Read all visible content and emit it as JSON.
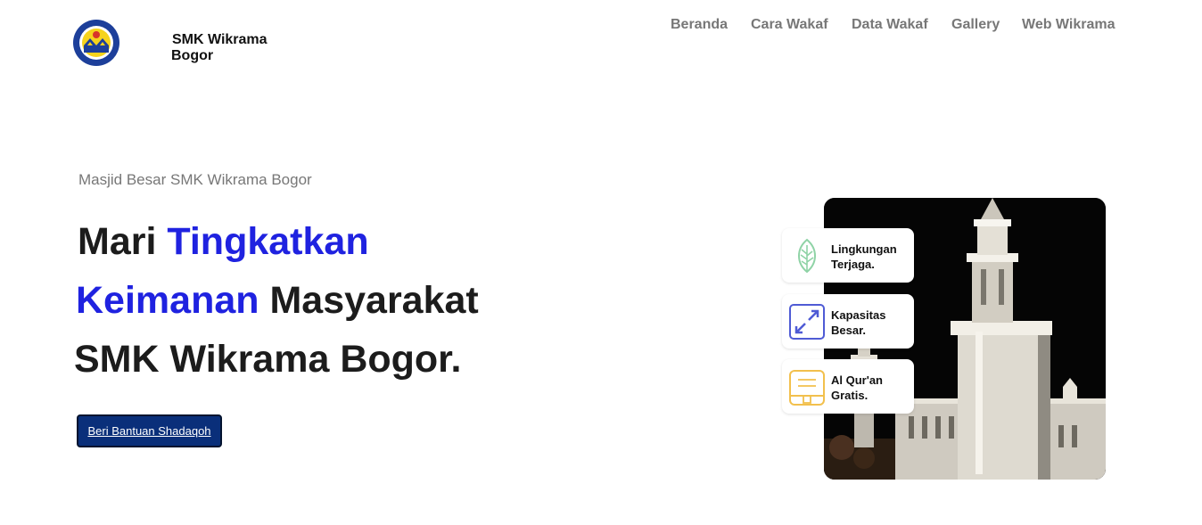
{
  "header": {
    "brand_line1": "SMK Wikrama",
    "brand_line2": "Bogor",
    "logo_icon": "smk-wikrama-logo-icon",
    "nav": [
      "Beranda",
      "Cara Wakaf",
      "Data Wakaf",
      "Gallery",
      "Web Wikrama"
    ]
  },
  "hero": {
    "subtitle": "Masjid Besar SMK Wikrama Bogor",
    "line1_a": "Mari",
    "line1_b": "Tingkatkan",
    "line2_a": "Keimanan",
    "line2_b": "Masyarakat",
    "line3": "SMK Wikrama Bogor.",
    "cta": "Beri Bantuan Shadaqoh"
  },
  "features": [
    {
      "icon": "leaf-icon",
      "line1": "Lingkungan",
      "line2": "Terjaga."
    },
    {
      "icon": "expand-icon",
      "line1": "Kapasitas",
      "line2": "Besar."
    },
    {
      "icon": "quran-icon",
      "line1": "Al Qur'an",
      "line2": "Gratis."
    }
  ],
  "image": {
    "subject": "mosque-night-photo"
  },
  "colors": {
    "accent_blue": "#1f22e0",
    "button_bg": "#0a2f7a",
    "nav_text": "#777777",
    "leaf_green": "#8fd3a6",
    "expand_blue": "#4f5bd5",
    "quran_gold": "#f2c04d"
  }
}
